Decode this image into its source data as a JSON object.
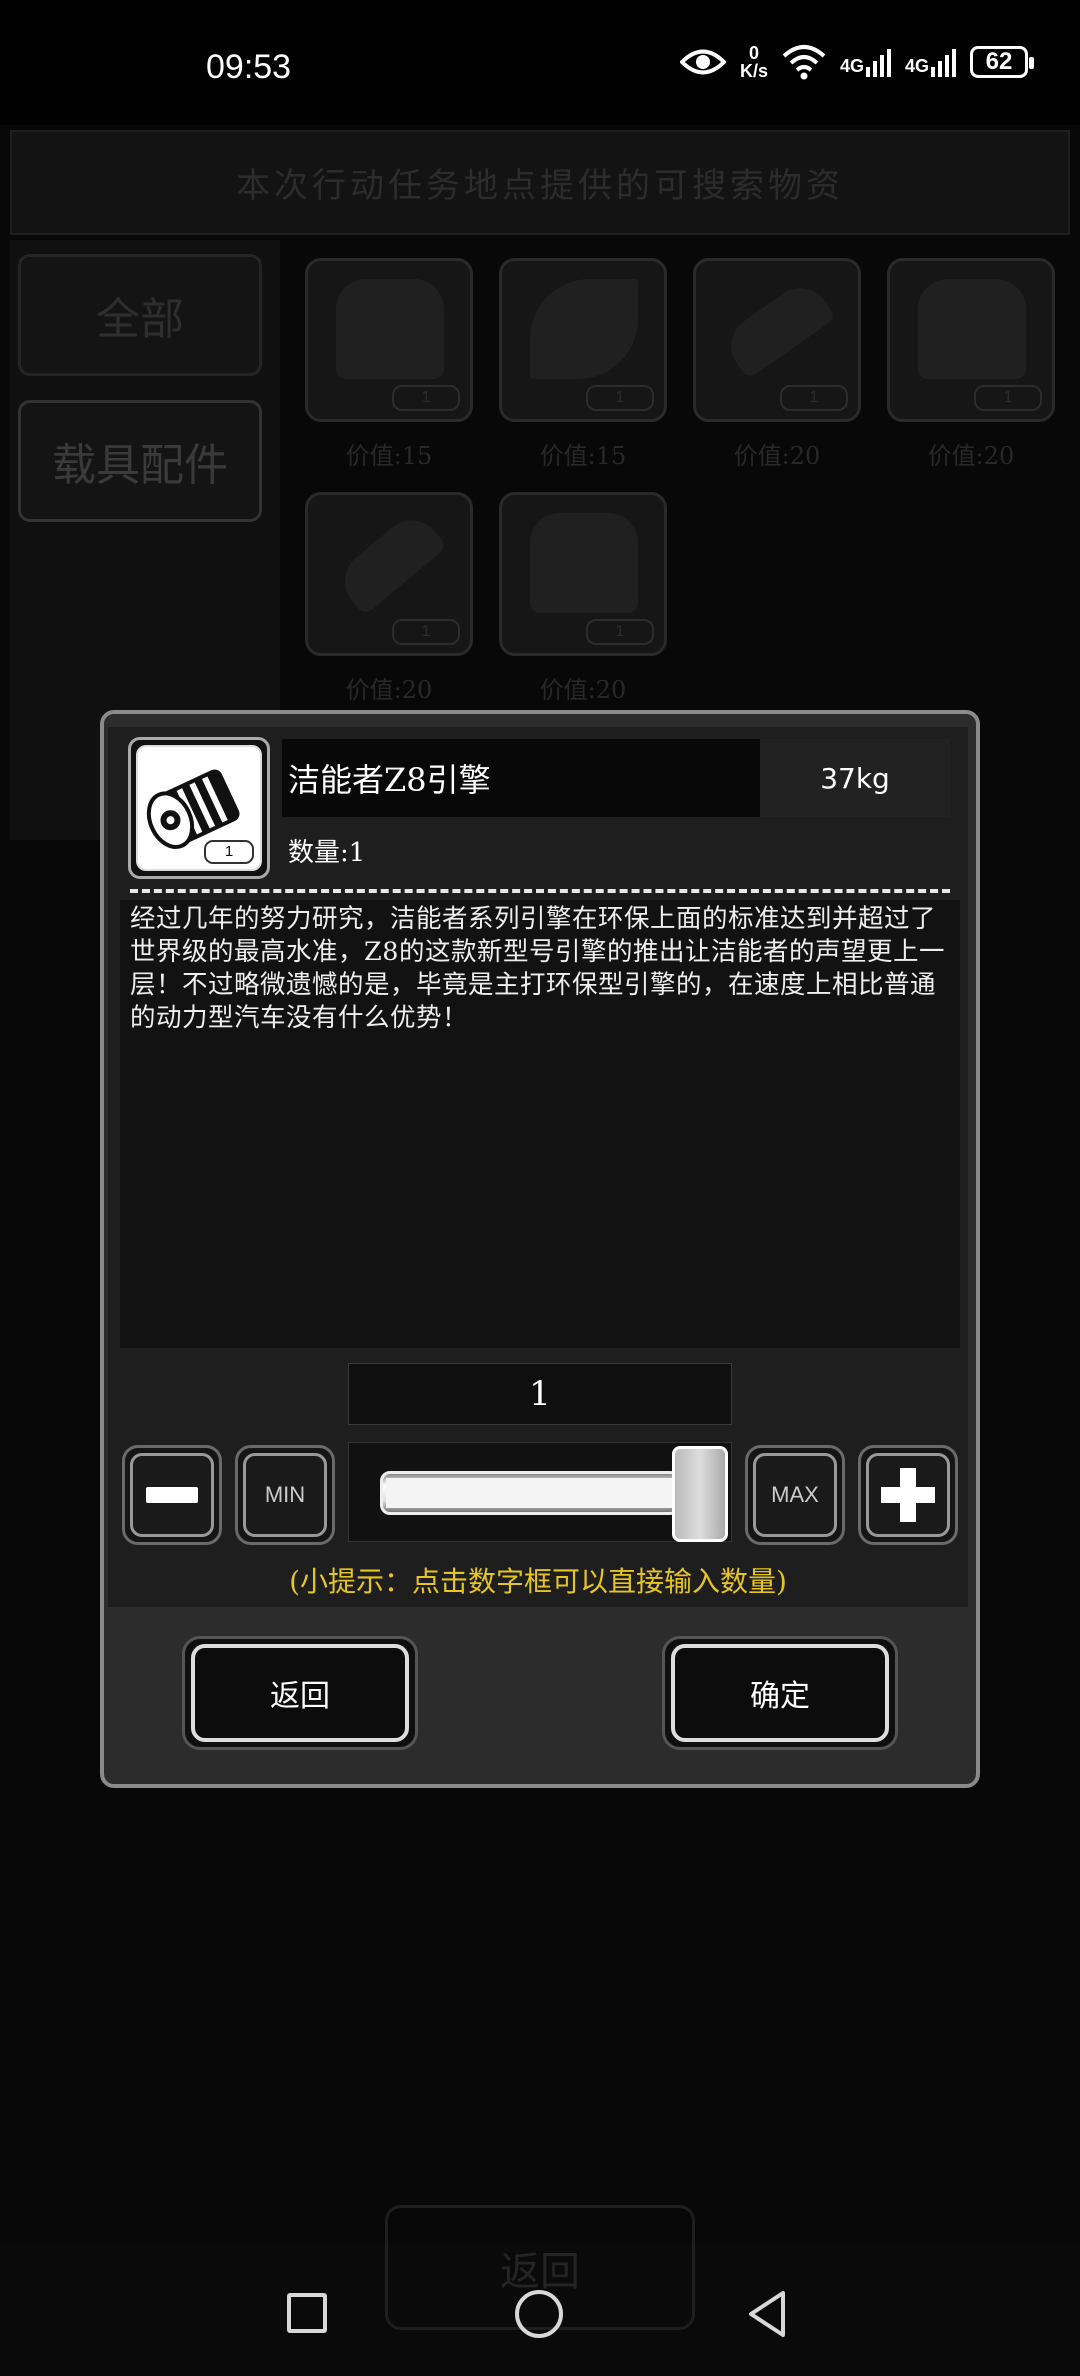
{
  "status_bar": {
    "time": "09:53",
    "speed_value": "0",
    "speed_unit": "K/s",
    "network_1": "4G",
    "network_2": "4G",
    "battery": "62",
    "icons": [
      "eye-icon",
      "wifi-icon",
      "signal-icon",
      "signal-icon",
      "battery-icon"
    ]
  },
  "background": {
    "header": "本次行动任务地点提供的可搜索物资",
    "categories": [
      "全部",
      "载具配件"
    ],
    "items": [
      {
        "count": "1",
        "price": "价值:15"
      },
      {
        "count": "1",
        "price": "价值:15"
      },
      {
        "count": "1",
        "price": "价值:20"
      },
      {
        "count": "1",
        "price": "价值:20"
      },
      {
        "count": "1",
        "price": "价值:20"
      },
      {
        "count": "1",
        "price": "价值:20"
      }
    ],
    "back_label": "返回"
  },
  "dialog": {
    "item_name": "洁能者Z8引擎",
    "weight": "37kg",
    "quantity_label": "数量:1",
    "item_count_badge": "1",
    "description": "经过几年的努力研究，洁能者系列引擎在环保上面的标准达到并超过了世界级的最高水准，Z8的这款新型号引擎的推出让洁能者的声望更上一层！不过略微遗憾的是，毕竟是主打环保型引擎的，在速度上相比普通的动力型汽车没有什么优势！",
    "number_value": "1",
    "min_label": "MIN",
    "max_label": "MAX",
    "slider_value": 1,
    "hint": "(小提示：点击数字框可以直接输入数量)",
    "back_button": "返回",
    "confirm_button": "确定",
    "colors": {
      "hint": "#e6c422",
      "panel": "#2c2c2c"
    }
  },
  "nav": {
    "icons": [
      "recent-apps-icon",
      "home-icon",
      "back-icon"
    ]
  }
}
